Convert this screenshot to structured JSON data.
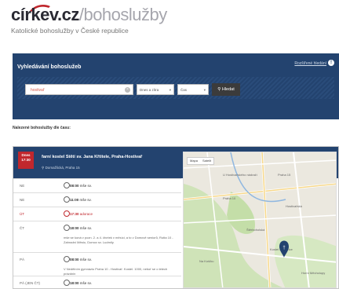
{
  "logo": {
    "main": "církev",
    "tld": ".cz",
    "section": "/bohoslužby",
    "tagline": "Katolické bohoslužby v České republice"
  },
  "search": {
    "title": "Vyhledávání bohoslužeb",
    "advanced_link": "Rozšířené hledání",
    "query": "hostivař",
    "select1": "Dnes a zítra",
    "select2": "Čas",
    "button": "Hledat"
  },
  "results_title": "Nalezené bohoslužby dle času:",
  "card": {
    "date_line1": "Dnes",
    "date_line2": "17:30",
    "title": "farní kostel Stětí sv. Jana Křtitele, Praha-Hostivař",
    "address": "Domažlická, Praha 15",
    "rows": [
      {
        "day": "NE",
        "time": "08:00",
        "type": "mše sv."
      },
      {
        "day": "NE",
        "time": "11:00",
        "type": "mše sv."
      },
      {
        "day": "ÚT",
        "time": "17:30",
        "type": "adorace"
      },
      {
        "day": "ČT",
        "time": "18:00",
        "type": "mše sv.",
        "note": "mše se koná v pozn. 2. a 4. čtvrtek v měsíci, a to v Domově seniorů, Rutta 10 - Zahradní Město, Domov sv. Ludmily."
      },
      {
        "day": "PÁ",
        "time": "08:00",
        "type": "mše sv.",
        "note": "V Nedělním gymnáziu Praha 10 - Hostivař. Kostel. 1000, neboť se o letech prázdnin"
      },
      {
        "day": "PÁ (JEN ČT)",
        "time": "18:00",
        "type": "mše sv."
      }
    ]
  },
  "map": {
    "tab_map": "Mapa",
    "tab_sat": "Satelit",
    "labels": [
      "Praha 10",
      "Praha 15",
      "Hostivařská",
      "Na Košíku",
      "Štěrboholská",
      "Kostel Petrovice",
      "Horní Měcholupy",
      "U Hostivařského nádraží"
    ]
  },
  "colors": {
    "navy": "#23436f",
    "red": "#c0272d"
  }
}
